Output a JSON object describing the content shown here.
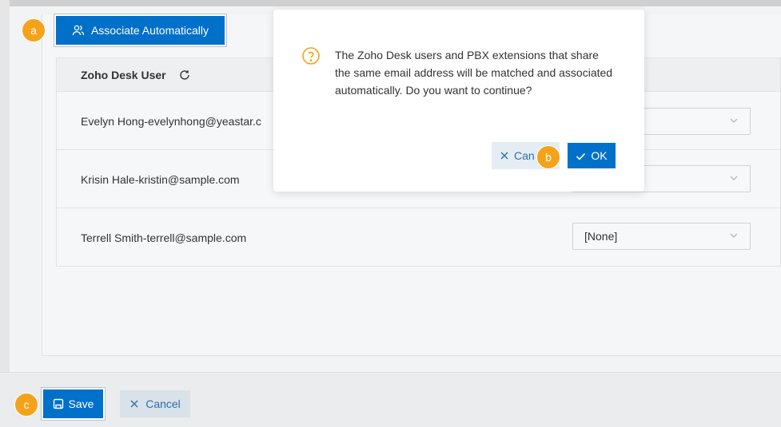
{
  "toolbar": {
    "associate_label": "Associate Automatically"
  },
  "table": {
    "header_user": "Zoho Desk User",
    "rows": [
      {
        "user": "Evelyn Hong-evelynhong@yeastar.c",
        "select_value": ""
      },
      {
        "user": "Krisin Hale-kristin@sample.com",
        "select_value": ""
      },
      {
        "user": "Terrell Smith-terrell@sample.com",
        "select_value": "[None]"
      }
    ]
  },
  "dialog": {
    "message": "The Zoho Desk users and PBX extensions that share the same email address will be matched and associated automatically. Do you want to continue?",
    "cancel_label": "Can",
    "ok_label": "OK"
  },
  "footer": {
    "save_label": "Save",
    "cancel_label": "Cancel"
  },
  "callouts": {
    "a": "a",
    "b": "b",
    "c": "c"
  },
  "colors": {
    "primary": "#0070c9",
    "callout": "#f5a21b",
    "question_icon": "#f5a21b"
  }
}
